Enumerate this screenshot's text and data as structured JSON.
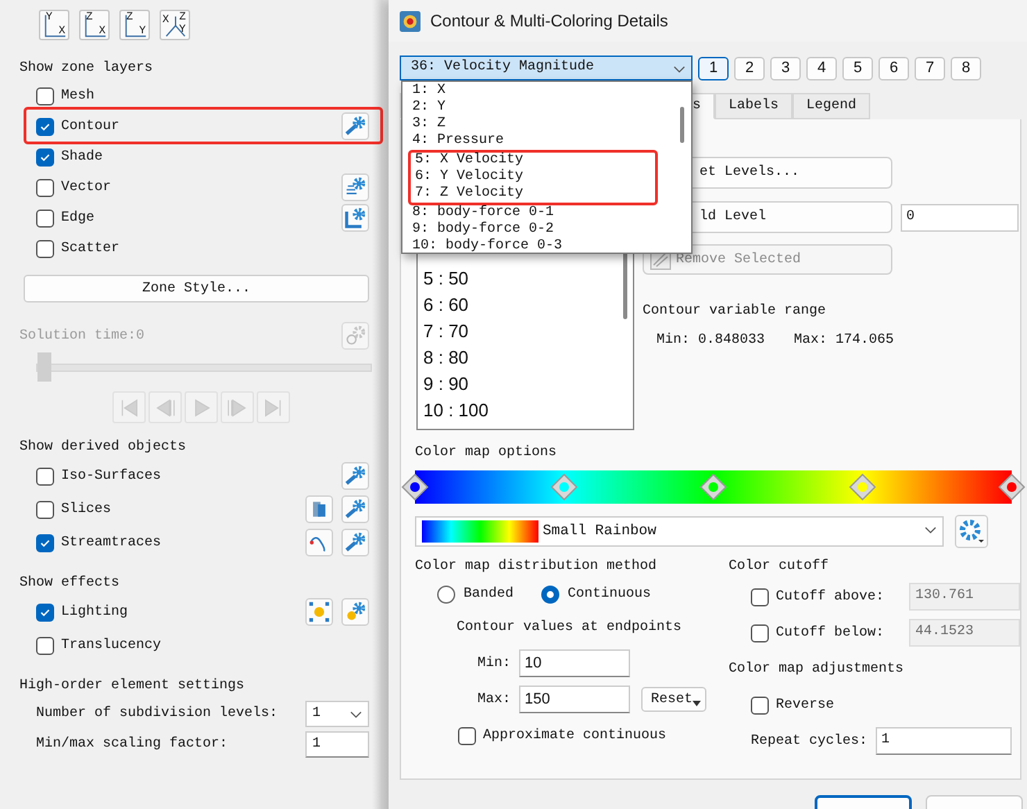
{
  "view_buttons": [
    {
      "axes": [
        "Y",
        "X"
      ]
    },
    {
      "axes": [
        "Z",
        "X"
      ]
    },
    {
      "axes": [
        "Z",
        "Y"
      ]
    },
    {
      "axes": [
        "X",
        "Z",
        "Y"
      ]
    }
  ],
  "zone_layers": {
    "heading": "Show zone layers",
    "items": [
      {
        "label": "Mesh",
        "checked": false,
        "highlighted": false
      },
      {
        "label": "Contour",
        "checked": true,
        "highlighted": true,
        "icons": [
          {
            "kind": "style"
          }
        ]
      },
      {
        "label": "Shade",
        "checked": true,
        "highlighted": false
      },
      {
        "label": "Vector",
        "checked": false,
        "highlighted": false,
        "icons": [
          {
            "kind": "vector"
          }
        ]
      },
      {
        "label": "Edge",
        "checked": false,
        "highlighted": false,
        "icons": [
          {
            "kind": "edge"
          }
        ]
      },
      {
        "label": "Scatter",
        "checked": false,
        "highlighted": false
      }
    ],
    "button": "Zone Style..."
  },
  "solution_time": {
    "label": "Solution time:0",
    "disabled": true,
    "level": 0
  },
  "derived": {
    "heading": "Show derived objects",
    "items": [
      {
        "label": "Iso-Surfaces",
        "checked": false,
        "icons": [
          {
            "kind": "style"
          }
        ]
      },
      {
        "label": "Slices",
        "checked": false,
        "icons": [
          {
            "kind": "slice"
          },
          {
            "kind": "style"
          }
        ]
      },
      {
        "label": "Streamtraces",
        "checked": true,
        "icons": [
          {
            "kind": "stream"
          },
          {
            "kind": "style"
          }
        ]
      }
    ]
  },
  "effects": {
    "heading": "Show effects",
    "items": [
      {
        "label": "Lighting",
        "checked": true,
        "icons": [
          {
            "kind": "light"
          },
          {
            "kind": "light-style"
          }
        ]
      },
      {
        "label": "Translucency",
        "checked": false
      }
    ]
  },
  "high_order": {
    "heading": "High-order element settings",
    "settings": [
      {
        "kind": "select",
        "label": "Number of subdivision levels:",
        "value": "1"
      },
      {
        "kind": "field",
        "label": "Min/max scaling factor:",
        "value": "1"
      }
    ]
  },
  "dialog": {
    "title": "Contour & Multi-Coloring Details",
    "variable": "36: Velocity Magnitude",
    "variable_options": [
      {
        "label": "1: X",
        "highlighted": false
      },
      {
        "label": "2: Y",
        "highlighted": false
      },
      {
        "label": "3: Z",
        "highlighted": false
      },
      {
        "label": "4: Pressure",
        "highlighted": false
      },
      {
        "label": "5: X Velocity",
        "highlighted": true
      },
      {
        "label": "6: Y Velocity",
        "highlighted": true
      },
      {
        "label": "7: Z Velocity",
        "highlighted": true
      },
      {
        "label": "8: body-force 0-1",
        "highlighted": false
      },
      {
        "label": "9: body-force 0-2",
        "highlighted": false
      },
      {
        "label": "10: body-force 0-3",
        "highlighted": false
      }
    ],
    "groups": [
      {
        "label": "1",
        "selected": true
      },
      {
        "label": "2",
        "selected": false
      },
      {
        "label": "3",
        "selected": false
      },
      {
        "label": "4",
        "selected": false
      },
      {
        "label": "5",
        "selected": false
      },
      {
        "label": "6",
        "selected": false
      },
      {
        "label": "7",
        "selected": false
      },
      {
        "label": "8",
        "selected": false
      }
    ],
    "tabs": [
      {
        "label": "s",
        "selected": true
      },
      {
        "label": "Labels",
        "selected": false
      },
      {
        "label": "Legend",
        "selected": false
      }
    ],
    "levels": [
      "5 : 50",
      "6 : 60",
      "7 : 70",
      "8 : 80",
      "9 : 90",
      "10 : 100"
    ],
    "set_levels": "et Levels...",
    "add_level": "ld Level",
    "add_value": "0",
    "remove": {
      "label": "Remove Selected",
      "disabled": true
    },
    "range": {
      "heading": "Contour variable range",
      "min": "Min: 0.848033",
      "max": "Max: 174.065"
    },
    "colormap": {
      "heading": "Color map options",
      "markers": [
        {
          "color": "#0000ff"
        },
        {
          "color": "#00ffff"
        },
        {
          "color": "#00ff00"
        },
        {
          "color": "#ffff00"
        },
        {
          "color": "#ff0000"
        }
      ],
      "name": "Small Rainbow"
    },
    "distribution": {
      "heading": "Color map distribution method",
      "options": [
        {
          "label": "Banded",
          "selected": false
        },
        {
          "label": "Continuous",
          "selected": true
        }
      ],
      "endpoints_heading": "Contour values at endpoints",
      "min": {
        "label": "Min:",
        "value": "10"
      },
      "max": {
        "label": "Max:",
        "value": "150"
      },
      "reset": "Reset",
      "approximate": {
        "label": "Approximate continuous",
        "checked": false
      }
    },
    "cutoff": {
      "heading": "Color cutoff",
      "items": [
        {
          "label": "Cutoff above:",
          "checked": false,
          "value": "130.761"
        },
        {
          "label": "Cutoff below:",
          "checked": false,
          "value": "44.1523"
        }
      ]
    },
    "adjustments": {
      "heading": "Color map adjustments",
      "reverse": {
        "label": "Reverse",
        "checked": false
      },
      "repeat": {
        "label": "Repeat cycles:",
        "value": "1"
      }
    }
  }
}
